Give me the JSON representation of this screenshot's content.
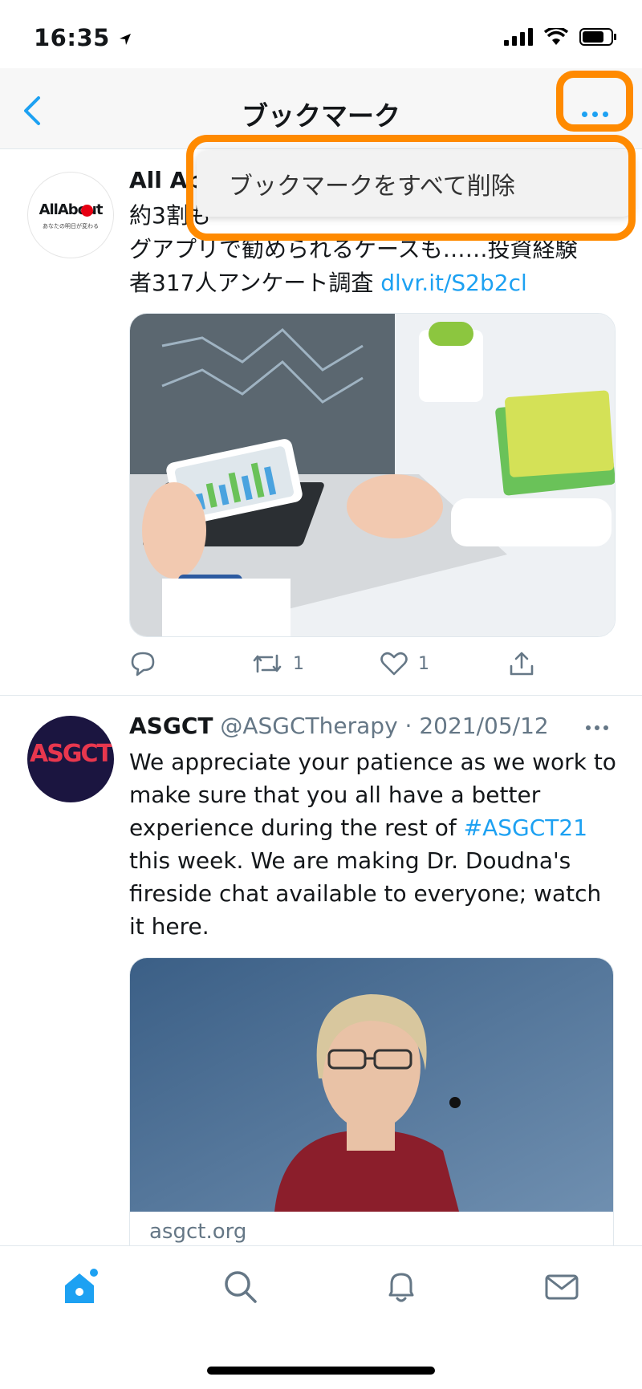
{
  "status": {
    "time": "16:35"
  },
  "header": {
    "title": "ブックマーク"
  },
  "menu": {
    "delete_all": "ブックマークをすべて削除"
  },
  "tweet1": {
    "author_name": "All Ab",
    "avatar_text": "AllAbout",
    "avatar_subtext": "あなたの明日が変わる",
    "text_line1": "約3割も",
    "text_line2": "グアプリで勧められるケースも……投資経験",
    "text_line3": "者317人アンケート調査",
    "link": "dlvr.it/S2b2cl",
    "retweets": "1",
    "likes": "1"
  },
  "tweet2": {
    "author_name": "ASGCT",
    "handle": "@ASGCTherapy",
    "separator": "·",
    "date": "2021/05/12",
    "avatar_text": "ASGCT",
    "text_before": "We appreciate your patience as we work to make sure that you all have a better experience during the rest of ",
    "hashtag": "#ASGCT21",
    "text_after": " this week. We are making Dr. Doudna's fireside chat available to everyone; watch it here.",
    "card_domain": "asgct.org"
  },
  "colors": {
    "accent": "#1da1f2",
    "highlight": "#ff8a00"
  }
}
